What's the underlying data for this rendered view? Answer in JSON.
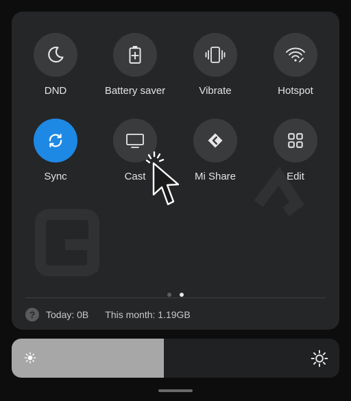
{
  "tiles": [
    {
      "label": "DND",
      "icon": "moon-icon",
      "active": false
    },
    {
      "label": "Battery saver",
      "icon": "battery-plus-icon",
      "active": false
    },
    {
      "label": "Vibrate",
      "icon": "vibrate-icon",
      "active": false
    },
    {
      "label": "Hotspot",
      "icon": "hotspot-icon",
      "active": false
    },
    {
      "label": "Sync",
      "icon": "sync-icon",
      "active": true
    },
    {
      "label": "Cast",
      "icon": "cast-icon",
      "active": false
    },
    {
      "label": "Mi Share",
      "icon": "mi-share-icon",
      "active": false
    },
    {
      "label": "Edit",
      "icon": "grid-icon",
      "active": false
    }
  ],
  "usage": {
    "today": "Today: 0B",
    "month": "This month: 1.19GB",
    "help_glyph": "?"
  },
  "pager": {
    "current": 2,
    "total": 2
  },
  "brightness": {
    "level": 0.465
  },
  "colors": {
    "panel": "#252627",
    "tile": "#3a3b3d",
    "active_tile": "#1e88e5",
    "brightness_fill": "#a7a7a7"
  }
}
